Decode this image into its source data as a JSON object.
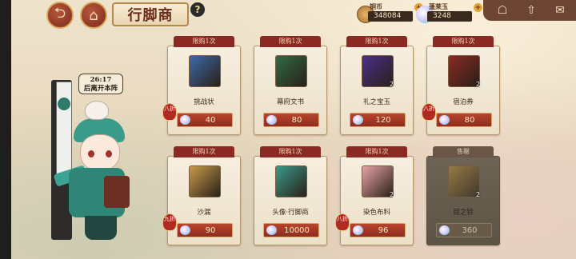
{
  "header": {
    "title": "行脚商",
    "back_label": "⮌",
    "home_label": "⌂",
    "help_label": "?"
  },
  "currencies": [
    {
      "name": "铜币",
      "value": "348084",
      "plus": "+"
    },
    {
      "name": "蓬莱玉",
      "value": "3248",
      "plus": "+"
    }
  ],
  "top_right_icons": [
    "mail-icon",
    "up-arrow-icon",
    "store-icon"
  ],
  "top_right_glyphs": {
    "store": "☖",
    "up": "⇧",
    "mail": "✉"
  },
  "merchant": {
    "timer": "26:17",
    "timer_caption": "后离开本阵"
  },
  "items": [
    {
      "limit": "限购1次",
      "name": "挑战状",
      "price": "40",
      "qty": "",
      "discount": "八折",
      "sold": false,
      "color": "#3b6aa8"
    },
    {
      "limit": "限购1次",
      "name": "幕府文书",
      "price": "80",
      "qty": "",
      "discount": "",
      "sold": false,
      "color": "#2f6b44"
    },
    {
      "limit": "限购1次",
      "name": "礼之宝玉",
      "price": "120",
      "qty": "2",
      "discount": "",
      "sold": false,
      "color": "#4a2f8a"
    },
    {
      "limit": "限购1次",
      "name": "宿泊券",
      "price": "80",
      "qty": "2",
      "discount": "八折",
      "sold": false,
      "color": "#8a2a22"
    },
    {
      "limit": "限购1次",
      "name": "沙漏",
      "price": "90",
      "qty": "",
      "discount": "九折",
      "sold": false,
      "color": "#c79a4a"
    },
    {
      "limit": "限购1次",
      "name": "头像·行脚商",
      "price": "10000",
      "qty": "",
      "discount": "",
      "sold": false,
      "color": "#3a9b8a"
    },
    {
      "limit": "限购1次",
      "name": "染色布料",
      "price": "96",
      "qty": "2",
      "discount": "八折",
      "sold": false,
      "color": "#e7a4a6"
    },
    {
      "limit": "售罄",
      "name": "目之铃",
      "price": "360",
      "qty": "2",
      "discount": "",
      "sold": true,
      "color": "#b08a3a"
    }
  ]
}
